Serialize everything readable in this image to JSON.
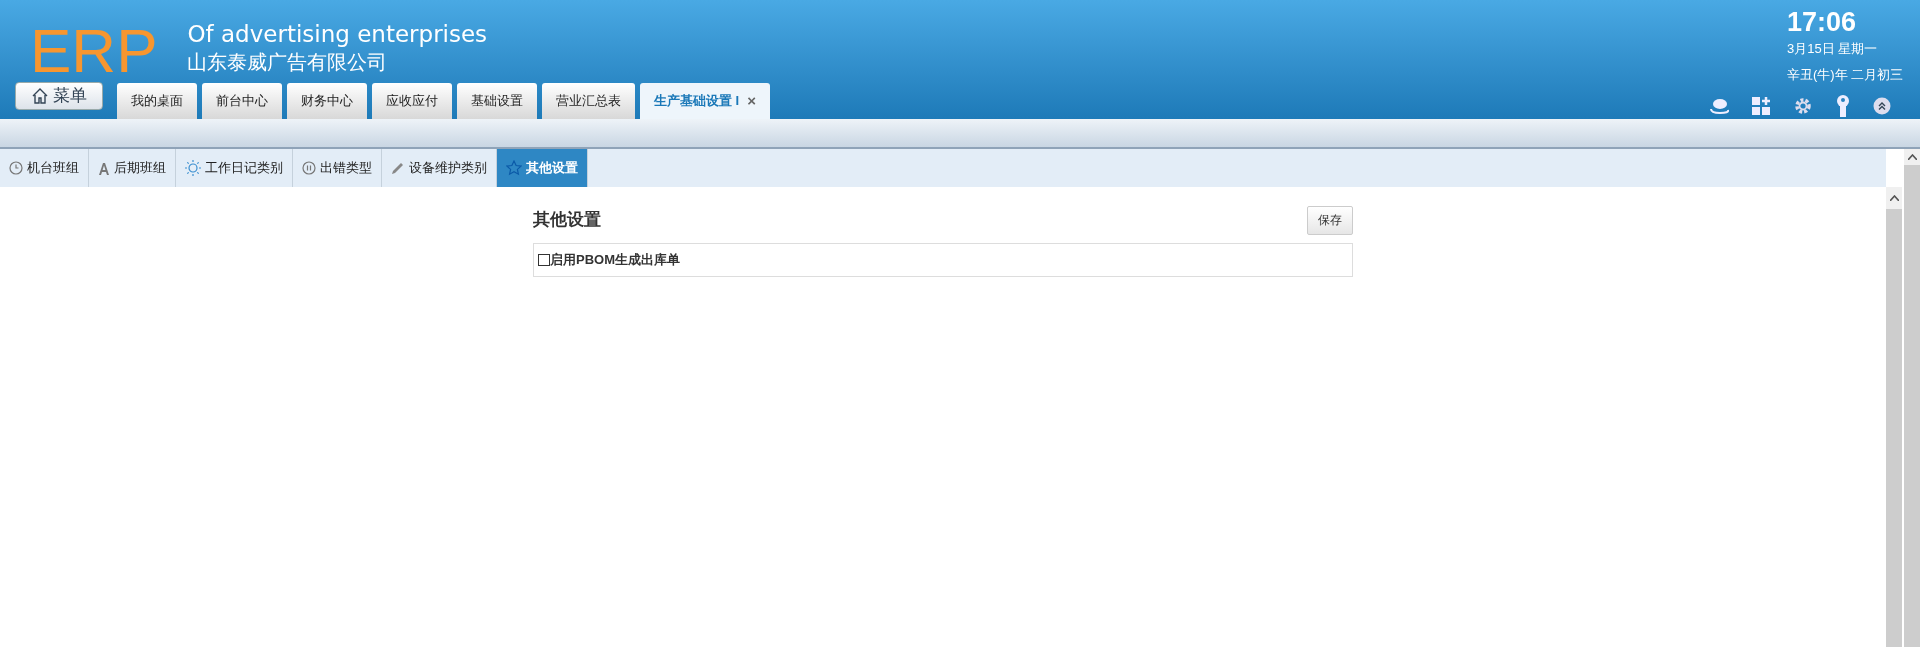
{
  "header": {
    "logo": "ERP",
    "subtitle": "Of advertising enterprises",
    "company": "山东泰威广告有限公司",
    "menu_button": "菜单",
    "time": "17:06",
    "date": "3月15日 星期一",
    "lunar_date": "辛丑(牛)年 二月初三"
  },
  "tabs": [
    {
      "label": "我的桌面",
      "selected": false
    },
    {
      "label": "前台中心",
      "selected": false
    },
    {
      "label": "财务中心",
      "selected": false
    },
    {
      "label": "应收应付",
      "selected": false
    },
    {
      "label": "基础设置",
      "selected": false
    },
    {
      "label": "营业汇总表",
      "selected": false
    },
    {
      "label": "生产基础设置 I",
      "selected": true,
      "close": "×"
    }
  ],
  "sub_tabs": [
    {
      "label": "机台班组",
      "kind": "clock",
      "selected": false
    },
    {
      "label": "后期班组",
      "kind": "letter",
      "selected": false
    },
    {
      "label": "工作日记类别",
      "kind": "sun",
      "selected": false
    },
    {
      "label": "出错类型",
      "kind": "pause",
      "selected": false
    },
    {
      "label": "设备维护类别",
      "kind": "pencil",
      "selected": false
    },
    {
      "label": "其他设置",
      "kind": "star",
      "selected": true
    }
  ],
  "panel": {
    "title": "其他设置",
    "save_button": "保存",
    "options": [
      {
        "label": "启用PBOM生成出库单",
        "checked": false
      }
    ]
  }
}
